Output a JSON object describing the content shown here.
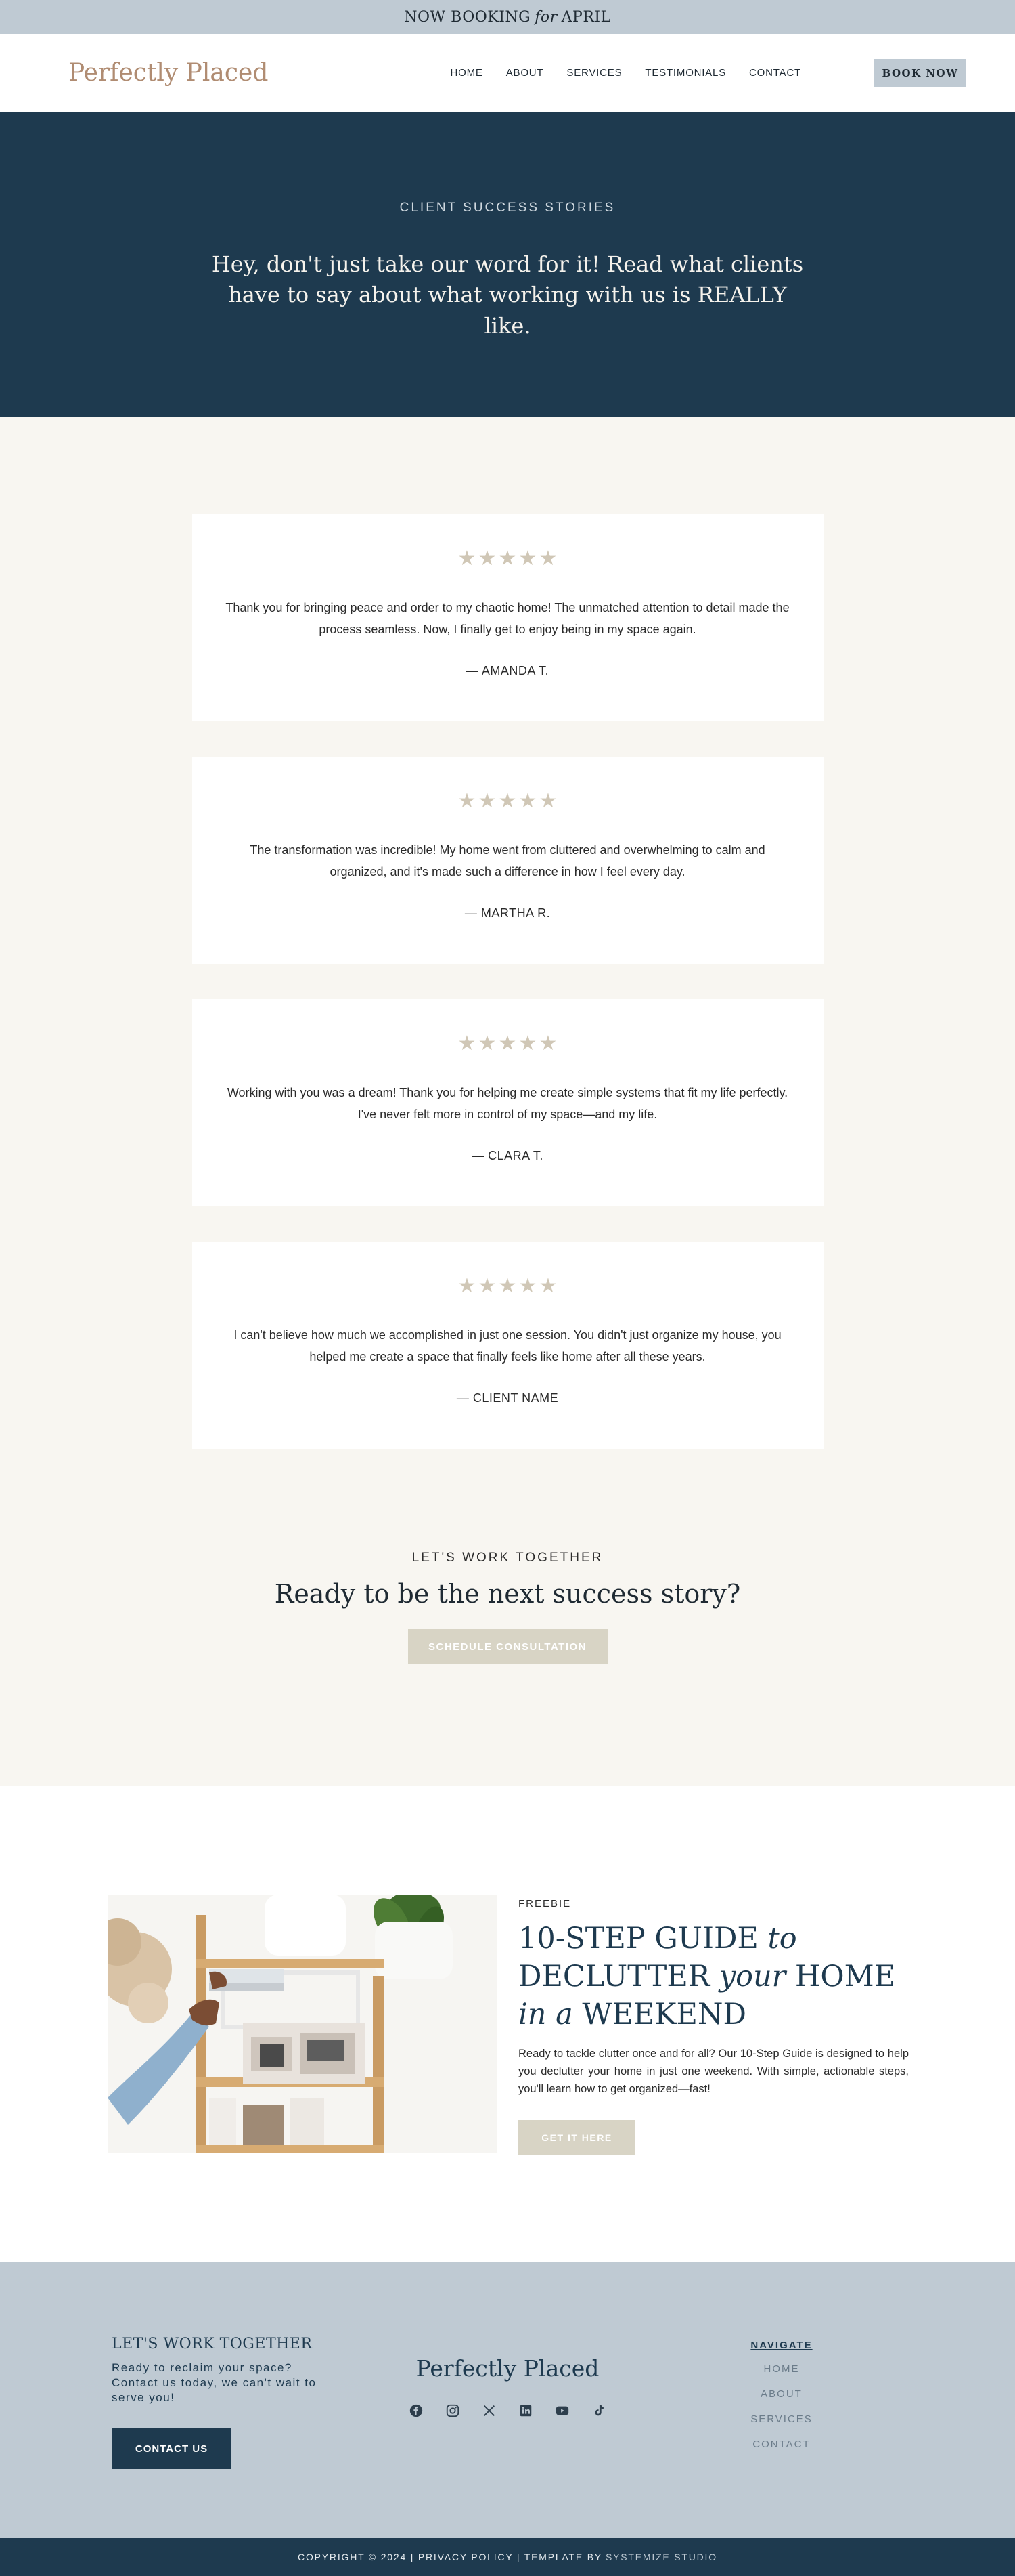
{
  "banner": {
    "prefix": "NOW BOOKING",
    "italic": "for",
    "suffix": "APRIL"
  },
  "header": {
    "logo": "Perfectly Placed",
    "nav": [
      "HOME",
      "ABOUT",
      "SERVICES",
      "TESTIMONIALS",
      "CONTACT"
    ],
    "book_label": "BOOK NOW"
  },
  "hero": {
    "eyebrow": "CLIENT SUCCESS STORIES",
    "headline": "Hey, don't just take our word for it! Read what clients have to say about what working with us is REALLY like."
  },
  "testimonials": [
    {
      "rating": 5,
      "quote": "Thank you for bringing peace and order to my chaotic home! The unmatched attention to detail made the process seamless. Now, I finally get to enjoy being in my space again.",
      "author": "— AMANDA T."
    },
    {
      "rating": 5,
      "quote": "The transformation was incredible! My home went from cluttered and overwhelming to calm and organized, and it's made such a difference in how I feel every day.",
      "author": "— MARTHA R."
    },
    {
      "rating": 5,
      "quote": "Working with you was a dream! Thank you for helping me create simple systems that fit my life perfectly. I've never felt more in control of my space—and my life.",
      "author": "— CLARA T."
    },
    {
      "rating": 5,
      "quote": "I can't believe how much we accomplished in just one session. You didn't just organize my house, you helped me create a space that finally feels like home after all these years.",
      "author": "— CLIENT NAME"
    }
  ],
  "cta": {
    "eyebrow": "LET'S WORK TOGETHER",
    "headline": "Ready to be the next success story?",
    "button": "SCHEDULE CONSULTATION"
  },
  "freebie": {
    "eyebrow": "FREEBIE",
    "title": {
      "t1": "10-STEP GUIDE ",
      "i1": "to",
      "t2": "DECLUTTER ",
      "i2": "your",
      "t3": " HOME ",
      "i3": "in a",
      "t4": " WEEKEND"
    },
    "body": "Ready to tackle clutter once and for all? Our 10-Step Guide is designed to help you declutter your home in just one weekend. With simple, actionable steps, you'll learn how to get organized—fast!",
    "button": "GET IT HERE"
  },
  "footer": {
    "heading": "LET'S WORK TOGETHER",
    "text": "Ready to reclaim your space? Contact us today, we can't wait to serve you!",
    "button": "CONTACT US",
    "logo": "Perfectly Placed",
    "socials": [
      "facebook-icon",
      "instagram-icon",
      "x-icon",
      "linkedin-icon",
      "youtube-icon",
      "tiktok-icon"
    ],
    "nav_title": "NAVIGATE",
    "nav": [
      "HOME",
      "ABOUT",
      "SERVICES",
      "CONTACT"
    ]
  },
  "copyright": {
    "text": "COPYRIGHT © 2024 | PRIVACY POLICY | TEMPLATE BY",
    "studio": "SYSTEMIZE STUDIO"
  },
  "colors": {
    "navy": "#1e3a4f",
    "slate": "#bfcad3",
    "cream": "#f8f6f1",
    "tan": "#b08c72",
    "star": "#d0c7b6",
    "button_beige": "#d8d4c5"
  }
}
